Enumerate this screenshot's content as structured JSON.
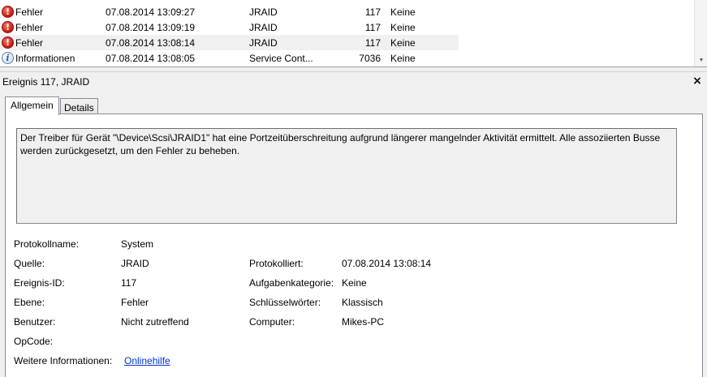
{
  "event_list": {
    "rows": [
      {
        "level": "Fehler",
        "icon": "error-icon",
        "date": "07.08.2014 13:09:27",
        "source": "JRAID",
        "event_id": "117",
        "category": "Keine"
      },
      {
        "level": "Fehler",
        "icon": "error-icon",
        "date": "07.08.2014 13:09:19",
        "source": "JRAID",
        "event_id": "117",
        "category": "Keine"
      },
      {
        "level": "Fehler",
        "icon": "error-icon",
        "date": "07.08.2014 13:08:14",
        "source": "JRAID",
        "event_id": "117",
        "category": "Keine"
      },
      {
        "level": "Informationen",
        "icon": "info-icon",
        "date": "07.08.2014 13:08:05",
        "source": "Service Cont...",
        "event_id": "7036",
        "category": "Keine"
      }
    ],
    "selected_row": 2
  },
  "detail": {
    "title": "Ereignis 117, JRAID",
    "close_glyph": "×",
    "tabs": [
      {
        "label": "Allgemein",
        "active": true
      },
      {
        "label": "Details",
        "active": false
      }
    ],
    "description": "Der Treiber für Gerät \"\\Device\\Scsi\\JRAID1\" hat eine Portzeitüberschreitung aufgrund längerer mangelnder Aktivität ermittelt. Alle assoziierten Busse werden zurückgesetzt, um den Fehler zu beheben.",
    "fields": {
      "log_name_label": "Protokollname:",
      "log_name": "System",
      "source_label": "Quelle:",
      "source": "JRAID",
      "logged_label": "Protokolliert:",
      "logged": "07.08.2014 13:08:14",
      "event_id_label": "Ereignis-ID:",
      "event_id": "117",
      "task_category_label": "Aufgabenkategorie:",
      "task_category": "Keine",
      "level_label": "Ebene:",
      "level": "Fehler",
      "keywords_label": "Schlüsselwörter:",
      "keywords": "Klassisch",
      "user_label": "Benutzer:",
      "user": "Nicht zutreffend",
      "computer_label": "Computer:",
      "computer": "Mikes-PC",
      "opcode_label": "OpCode:",
      "more_info_label": "Weitere Informationen:",
      "more_info_link": "Onlinehilfe"
    }
  },
  "colors": {
    "error": "#c6160d",
    "info": "#2a5aa8",
    "link": "#0033cc",
    "selected_row": "#f0f0f0"
  }
}
